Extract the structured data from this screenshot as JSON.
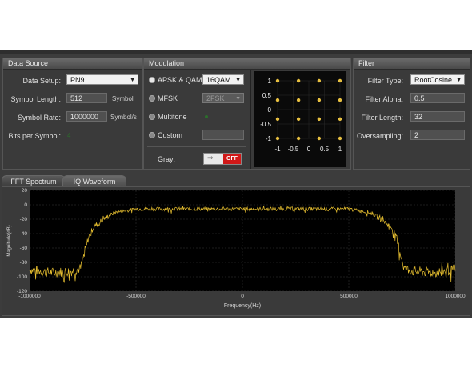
{
  "data_source": {
    "title": "Data Source",
    "data_setup": {
      "label": "Data Setup:",
      "value": "PN9"
    },
    "symbol_length": {
      "label": "Symbol Length:",
      "value": "512",
      "unit": "Symbol"
    },
    "symbol_rate": {
      "label": "Symbol Rate:",
      "value": "1000000",
      "unit": "Symbol/s"
    },
    "bits_per_symbol": {
      "label": "Bits per Symbol:",
      "value": "4"
    }
  },
  "modulation": {
    "title": "Modulation",
    "apsk_qam": {
      "label": "APSK & QAM",
      "value": "16QAM",
      "selected": true
    },
    "mfsk": {
      "label": "MFSK",
      "value": "2FSK"
    },
    "multitone": {
      "label": "Multitone"
    },
    "custom": {
      "label": "Custom"
    },
    "gray": {
      "label": "Gray:",
      "state": "OFF"
    },
    "constellation": {
      "x_ticks": [
        "-1",
        "-0.5",
        "0",
        "0.5",
        "1"
      ],
      "y_ticks": [
        "1",
        "0.5",
        "0",
        "-0.5",
        "-1"
      ],
      "points": [
        [
          -1,
          1
        ],
        [
          -0.33,
          1
        ],
        [
          0.33,
          1
        ],
        [
          1,
          1
        ],
        [
          -1,
          0.33
        ],
        [
          -0.33,
          0.33
        ],
        [
          0.33,
          0.33
        ],
        [
          1,
          0.33
        ],
        [
          -1,
          -0.33
        ],
        [
          -0.33,
          -0.33
        ],
        [
          0.33,
          -0.33
        ],
        [
          1,
          -0.33
        ],
        [
          -1,
          -1
        ],
        [
          -0.33,
          -1
        ],
        [
          0.33,
          -1
        ],
        [
          1,
          -1
        ]
      ],
      "point_color": "#e8c040"
    }
  },
  "filter": {
    "title": "Filter",
    "filter_type": {
      "label": "Filter Type:",
      "value": "RootCosine"
    },
    "filter_alpha": {
      "label": "Filter Alpha:",
      "value": "0.5"
    },
    "filter_length": {
      "label": "Filter Length:",
      "value": "32"
    },
    "oversampling": {
      "label": "Oversampling:",
      "value": "2"
    }
  },
  "tabs": [
    "FFT Spectrum",
    "IQ Waveform"
  ],
  "chart_data": {
    "type": "line",
    "xlabel": "Frequency(Hz)",
    "ylabel": "Magnitude(dB)",
    "xlim": [
      -1000000,
      1000000
    ],
    "ylim": [
      -120,
      20
    ],
    "x_ticks": [
      "-1000000",
      "-500000",
      "0",
      "500000",
      "1000000"
    ],
    "y_ticks": [
      "20",
      "0",
      "-20",
      "-40",
      "-60",
      "-80",
      "-100",
      "-120"
    ],
    "grid": true,
    "line_color": "#e8c030",
    "series": [
      {
        "x": [
          -1000000,
          -900000,
          -800000,
          -760000,
          -740000,
          -720000,
          -700000,
          -650000,
          -600000,
          -500000,
          -400000,
          -300000,
          -200000,
          -100000,
          0,
          100000,
          200000,
          300000,
          400000,
          500000,
          600000,
          650000,
          700000,
          720000,
          740000,
          760000,
          800000,
          900000,
          1000000
        ],
        "values": [
          -88,
          -92,
          -90,
          -86,
          -62,
          -42,
          -30,
          -18,
          -10,
          -5,
          -5,
          -5,
          -5,
          -5,
          -5,
          -5,
          -5,
          -5,
          -5,
          -5,
          -10,
          -18,
          -30,
          -42,
          -62,
          -86,
          -90,
          -92,
          -88
        ]
      }
    ]
  }
}
